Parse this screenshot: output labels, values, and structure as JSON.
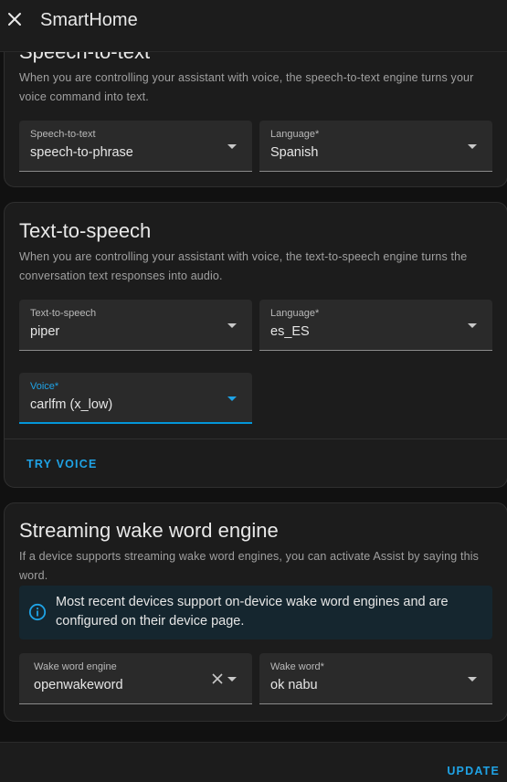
{
  "header": {
    "title": "SmartHome",
    "close_icon": "close-icon"
  },
  "stt": {
    "title": "Speech-to-text",
    "description": "When you are controlling your assistant with voice, the speech-to-text engine turns your voice command into text.",
    "engine": {
      "label": "Speech-to-text",
      "value": "speech-to-phrase"
    },
    "language": {
      "label": "Language*",
      "value": "Spanish"
    }
  },
  "tts": {
    "title": "Text-to-speech",
    "description": "When you are controlling your assistant with voice, the text-to-speech engine turns the conversation text responses into audio.",
    "engine": {
      "label": "Text-to-speech",
      "value": "piper"
    },
    "language": {
      "label": "Language*",
      "value": "es_ES"
    },
    "voice": {
      "label": "Voice*",
      "value": "carlfm (x_low)"
    },
    "try_voice": "TRY VOICE"
  },
  "wake": {
    "title": "Streaming wake word engine",
    "description": "If a device supports streaming wake word engines, you can activate Assist by saying this word.",
    "info": "Most recent devices support on-device wake word engines and are configured on their device page.",
    "engine": {
      "label": "Wake word engine",
      "value": "openwakeword"
    },
    "word": {
      "label": "Wake word*",
      "value": "ok nabu"
    }
  },
  "footer": {
    "update_label": "UPDATE"
  },
  "colors": {
    "accent": "#1fa3e6",
    "background": "#111111",
    "card": "#1c1c1c",
    "field": "#2a2a2a",
    "info_bg": "#15262f"
  }
}
